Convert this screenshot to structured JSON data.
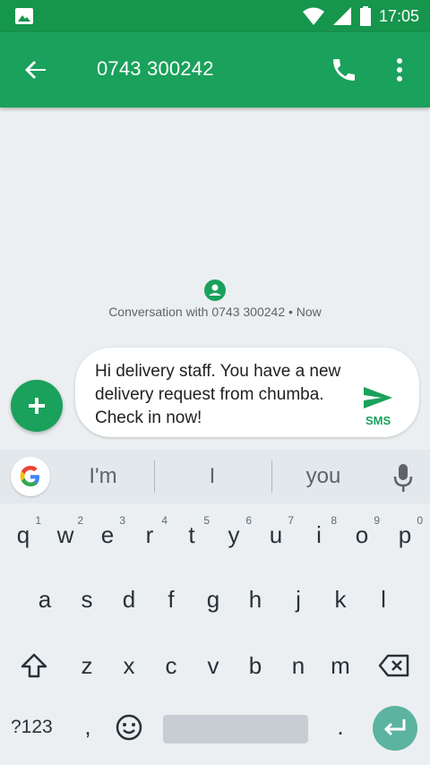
{
  "status_bar": {
    "time": "17:05",
    "icons": [
      "image-icon",
      "wifi-icon",
      "signal-icon",
      "battery-icon"
    ]
  },
  "app_bar": {
    "title": "0743 300242",
    "icons": [
      "back-arrow-icon",
      "phone-icon",
      "more-vert-icon"
    ]
  },
  "conversation": {
    "info": "Conversation with 0743 300242 • Now"
  },
  "composer": {
    "message": "Hi delivery staff. You have a new delivery request from chumba. Check in now!",
    "send_label": "SMS"
  },
  "keyboard": {
    "suggestions": [
      "I'm",
      "I",
      "you"
    ],
    "row1": [
      "q",
      "w",
      "e",
      "r",
      "t",
      "y",
      "u",
      "i",
      "o",
      "p"
    ],
    "row1_numbers": [
      "1",
      "2",
      "3",
      "4",
      "5",
      "6",
      "7",
      "8",
      "9",
      "0"
    ],
    "row2": [
      "a",
      "s",
      "d",
      "f",
      "g",
      "h",
      "j",
      "k",
      "l"
    ],
    "row3": [
      "z",
      "x",
      "c",
      "v",
      "b",
      "n",
      "m"
    ],
    "symbols_key": "?123",
    "comma_key": ",",
    "period_key": "."
  },
  "colors": {
    "primary": "#1aa15b",
    "primary_dark": "#16954c",
    "enter": "#5bb3a0"
  }
}
